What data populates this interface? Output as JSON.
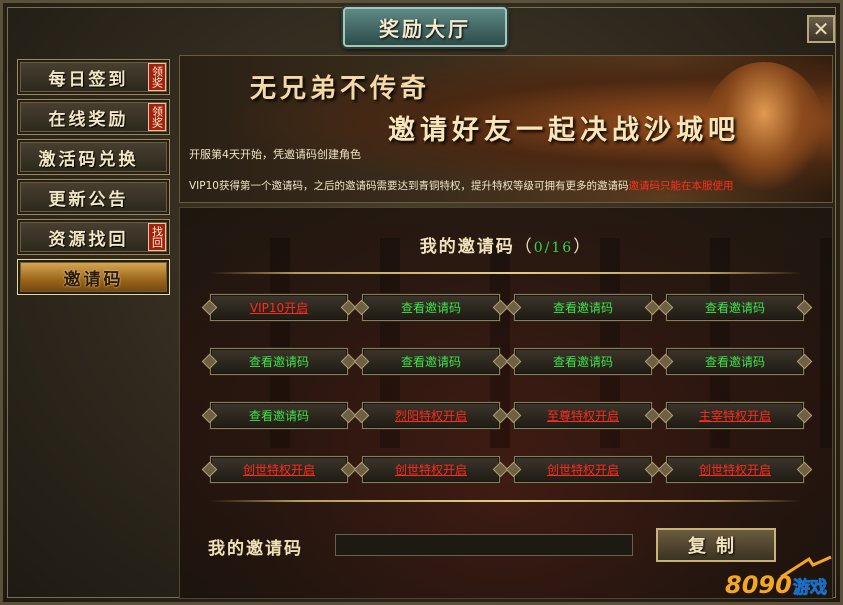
{
  "window": {
    "title": "奖励大厅",
    "close_glyph": "✕"
  },
  "sidebar": {
    "items": [
      {
        "label": "每日签到",
        "badge": "领奖",
        "active": false
      },
      {
        "label": "在线奖励",
        "badge": "领奖",
        "active": false
      },
      {
        "label": "激活码兑换",
        "badge": "",
        "active": false
      },
      {
        "label": "更新公告",
        "badge": "",
        "active": false
      },
      {
        "label": "资源找回",
        "badge": "找回",
        "active": false
      },
      {
        "label": "邀请码",
        "badge": "",
        "active": true
      }
    ]
  },
  "banner": {
    "slogan1": "无兄弟不传奇",
    "slogan2": "邀请好友一起决战沙城吧",
    "info1": "开服第4天开始，凭邀请码创建角色",
    "info2_prefix": "VIP10获得第一个邀请码，之后的邀请码需要达到青铜特权，提升特权等级可拥有更多的邀请码",
    "info2_warning": "邀请码只能在本服使用"
  },
  "invite": {
    "title": "我的邀请码",
    "paren_open": "（",
    "count": "0/16",
    "paren_close": "）",
    "codes": [
      {
        "label": "VIP10开启",
        "state": "locked"
      },
      {
        "label": "查看邀请码",
        "state": "available"
      },
      {
        "label": "查看邀请码",
        "state": "available"
      },
      {
        "label": "查看邀请码",
        "state": "available"
      },
      {
        "label": "查看邀请码",
        "state": "available"
      },
      {
        "label": "查看邀请码",
        "state": "available"
      },
      {
        "label": "查看邀请码",
        "state": "available"
      },
      {
        "label": "查看邀请码",
        "state": "available"
      },
      {
        "label": "查看邀请码",
        "state": "available"
      },
      {
        "label": "烈阳特权开启",
        "state": "locked"
      },
      {
        "label": "至尊特权开启",
        "state": "locked"
      },
      {
        "label": "主宰特权开启",
        "state": "locked"
      },
      {
        "label": "创世特权开启",
        "state": "locked"
      },
      {
        "label": "创世特权开启",
        "state": "locked"
      },
      {
        "label": "创世特权开启",
        "state": "locked"
      },
      {
        "label": "创世特权开启",
        "state": "locked"
      }
    ],
    "input_label": "我的邀请码",
    "input_value": "",
    "copy_label": "复制"
  },
  "watermark": {
    "text_num": "8090",
    "text_cn": "游戏"
  },
  "colors": {
    "available": "#3fe34a",
    "locked": "#ff2a1a",
    "accent_gold": "#e0b05a"
  }
}
